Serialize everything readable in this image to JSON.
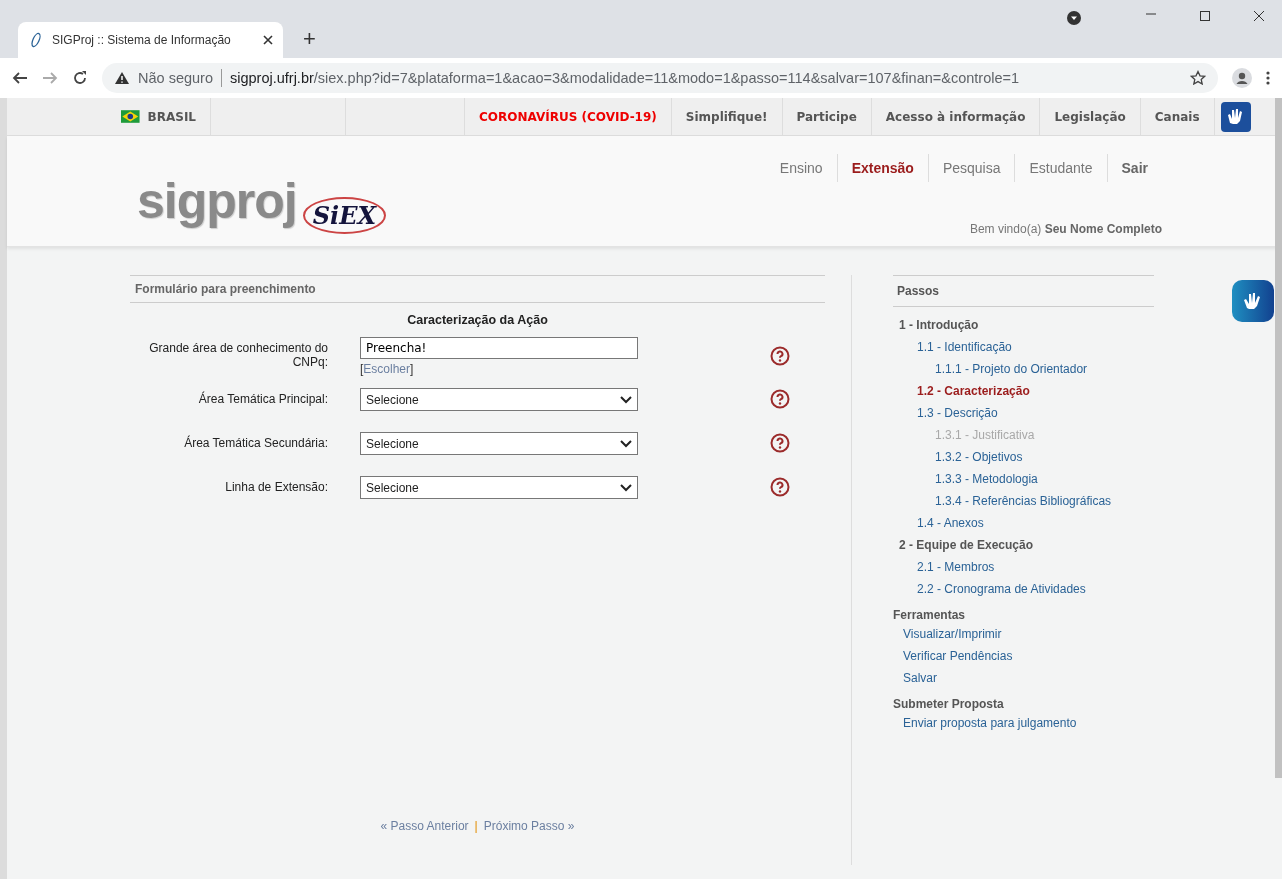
{
  "browser": {
    "tab_title": "SIGProj :: Sistema de Informação",
    "new_tab": "+",
    "security": "Não seguro",
    "url_host": "sigproj.ufrj.br",
    "url_path": "/siex.php?id=7&plataforma=1&acao=3&modalidade=11&modo=1&passo=114&salvar=107&finan=&controle=1"
  },
  "gov_bar": {
    "country": "BRASIL",
    "links": [
      {
        "label": "CORONAVÍRUS (COVID-19)",
        "kind": "alert"
      },
      {
        "label": "Simplifique!",
        "kind": "normal"
      },
      {
        "label": "Participe",
        "kind": "normal"
      },
      {
        "label": "Acesso à informação",
        "kind": "normal"
      },
      {
        "label": "Legislação",
        "kind": "normal"
      },
      {
        "label": "Canais",
        "kind": "normal"
      }
    ]
  },
  "header": {
    "logo": "sigproj",
    "logo_sub": "SiEX",
    "nav": [
      {
        "label": "Ensino",
        "selected": false,
        "kind": "link"
      },
      {
        "label": "Extensão",
        "selected": true,
        "kind": "link"
      },
      {
        "label": "Pesquisa",
        "selected": false,
        "kind": "link"
      },
      {
        "label": "Estudante",
        "selected": false,
        "kind": "link"
      },
      {
        "label": "Sair",
        "selected": false,
        "kind": "action"
      }
    ],
    "welcome": "Bem vindo(a) **Seu Nome Completo**"
  },
  "form": {
    "panel_title": "Formulário para preenchimento",
    "title": "Caracterização da Ação",
    "fields": [
      {
        "label": "Grande área de conhecimento do CNPq:",
        "kind": "text",
        "value": "Preencha!",
        "link_open": "[",
        "link": "Escolher",
        "link_close": "]"
      },
      {
        "label": "Área Temática Principal:",
        "kind": "select",
        "value": "Selecione"
      },
      {
        "label": "Área Temática Secundária:",
        "kind": "select",
        "value": "Selecione"
      },
      {
        "label": "Linha de Extensão:",
        "kind": "select",
        "value": "Selecione"
      }
    ],
    "prev": "« Passo Anterior",
    "separator": "|",
    "next": "Próximo Passo »"
  },
  "steps": {
    "title": "Passos",
    "items": [
      {
        "label": "1 - Introdução",
        "selected": false,
        "disabled": false,
        "children": [
          {
            "label": "1.1 - Identificação",
            "selected": false,
            "disabled": false,
            "children": [
              {
                "label": "1.1.1 - Projeto do Orientador",
                "selected": false,
                "disabled": false
              }
            ]
          },
          {
            "label": "1.2 - Caracterização",
            "selected": true,
            "disabled": false
          },
          {
            "label": "1.3 - Descrição",
            "selected": false,
            "disabled": false,
            "children": [
              {
                "label": "1.3.1 - Justificativa",
                "selected": false,
                "disabled": true
              },
              {
                "label": "1.3.2 - Objetivos",
                "selected": false,
                "disabled": false
              },
              {
                "label": "1.3.3 - Metodologia",
                "selected": false,
                "disabled": false
              },
              {
                "label": "1.3.4 - Referências Bibliográficas",
                "selected": false,
                "disabled": false
              }
            ]
          },
          {
            "label": "1.4 - Anexos",
            "selected": false,
            "disabled": false
          }
        ]
      },
      {
        "label": "2 - Equipe de Execução",
        "selected": false,
        "disabled": false,
        "children": [
          {
            "label": "2.1 - Membros",
            "selected": false,
            "disabled": false
          },
          {
            "label": "2.2 - Cronograma de Atividades",
            "selected": false,
            "disabled": false
          }
        ]
      }
    ],
    "sections": [
      {
        "title": "Ferramentas",
        "links": [
          "Visualizar/Imprimir",
          "Verificar Pendências",
          "Salvar"
        ]
      },
      {
        "title": "Submeter Proposta",
        "links": [
          "Enviar proposta para julgamento"
        ]
      }
    ]
  }
}
